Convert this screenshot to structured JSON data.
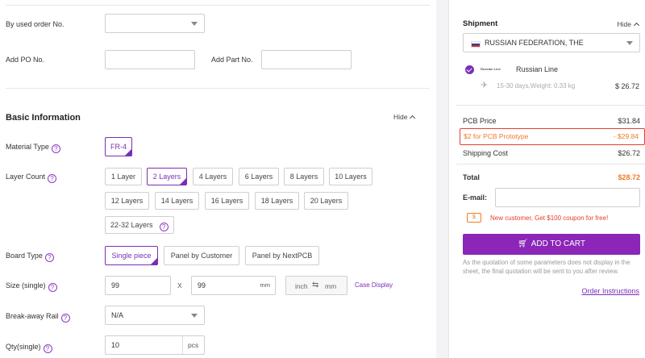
{
  "form": {
    "used_order_label": "By used order No.",
    "add_po_label": "Add PO No.",
    "add_part_label": "Add Part No.",
    "section_title": "Basic Information",
    "hide_label": "Hide",
    "material_label": "Material Type",
    "material_value": "FR-4",
    "layer_label": "Layer Count",
    "layers": [
      "1 Layer",
      "2 Layers",
      "4 Layers",
      "6 Layers",
      "8 Layers",
      "10 Layers",
      "12 Layers",
      "14 Layers",
      "16 Layers",
      "18 Layers",
      "20 Layers",
      "22-32 Layers"
    ],
    "selected_layer": "2 Layers",
    "board_label": "Board Type",
    "board_types": [
      "Single piece",
      "Panel by Customer",
      "Panel by NextPCB"
    ],
    "selected_board": "Single piece",
    "size_label": "Size (single)",
    "size_w": "99",
    "size_h": "99",
    "size_x": "X",
    "size_unit": "mm",
    "unit_inch": "inch",
    "unit_mm": "mm",
    "case_display": "Case Display",
    "breakaway_label": "Break-away Rail",
    "breakaway_value": "N/A",
    "qty_label": "Qty(single)",
    "qty_value": "10",
    "qty_unit": "pcs",
    "help_glyph": "?"
  },
  "summary": {
    "shipment_title": "Shipment",
    "hide_label": "Hide",
    "country": "RUSSIAN FEDERATION, THE",
    "carrier_logo_text": "Russian Line",
    "carrier_name": "Russian Line",
    "delivery": "15-30 days,Weight: 0.33 kg",
    "shipping_price": "$ 26.72",
    "pcb_price_label": "PCB Price",
    "pcb_price": "$31.84",
    "promo_label": "$2 for PCB Prototype",
    "promo_value": "- $29.84",
    "shipping_cost_label": "Shipping Cost",
    "shipping_cost": "$26.72",
    "total_label": "Total",
    "total_value": "$28.72",
    "email_label": "E-mail:",
    "coupon_text": "New customer, Get $100 coupon for free!",
    "cart_label": "ADD TO CART",
    "note": "As the quotation of some parameters does not display in the sheet, the final quotation will be sent to you after review.",
    "order_instructions": "Order Instructions"
  },
  "colors": {
    "accent": "#8b26b8",
    "promo_border": "#e3402d",
    "total": "#f07a24"
  }
}
